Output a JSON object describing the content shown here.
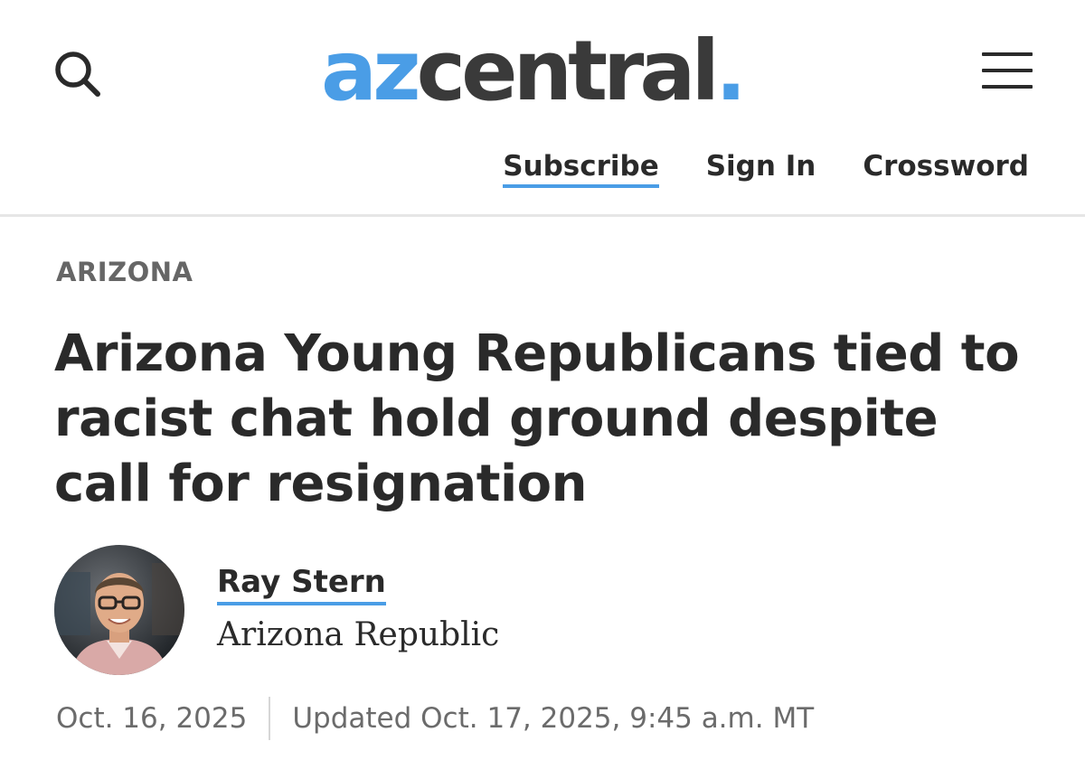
{
  "header": {
    "logo": {
      "part1": "az",
      "part2": "central",
      "dot": "."
    },
    "search_icon": "search-icon",
    "menu_icon": "hamburger-menu-icon",
    "nav": {
      "subscribe": "Subscribe",
      "sign_in": "Sign In",
      "crossword": "Crossword"
    }
  },
  "article": {
    "section": "ARIZONA",
    "headline": "Arizona Young Republicans tied to racist chat hold ground despite call for resignation",
    "author": {
      "name": "Ray Stern",
      "organization": "Arizona Republic",
      "avatar_icon": "author-photo"
    },
    "published": "Oct. 16, 2025",
    "updated": "Updated Oct. 17, 2025, 9:45 a.m. MT"
  },
  "colors": {
    "brand_blue": "#4a9de6",
    "text_dark": "#2a2a2a",
    "text_muted": "#6b6b6b"
  }
}
